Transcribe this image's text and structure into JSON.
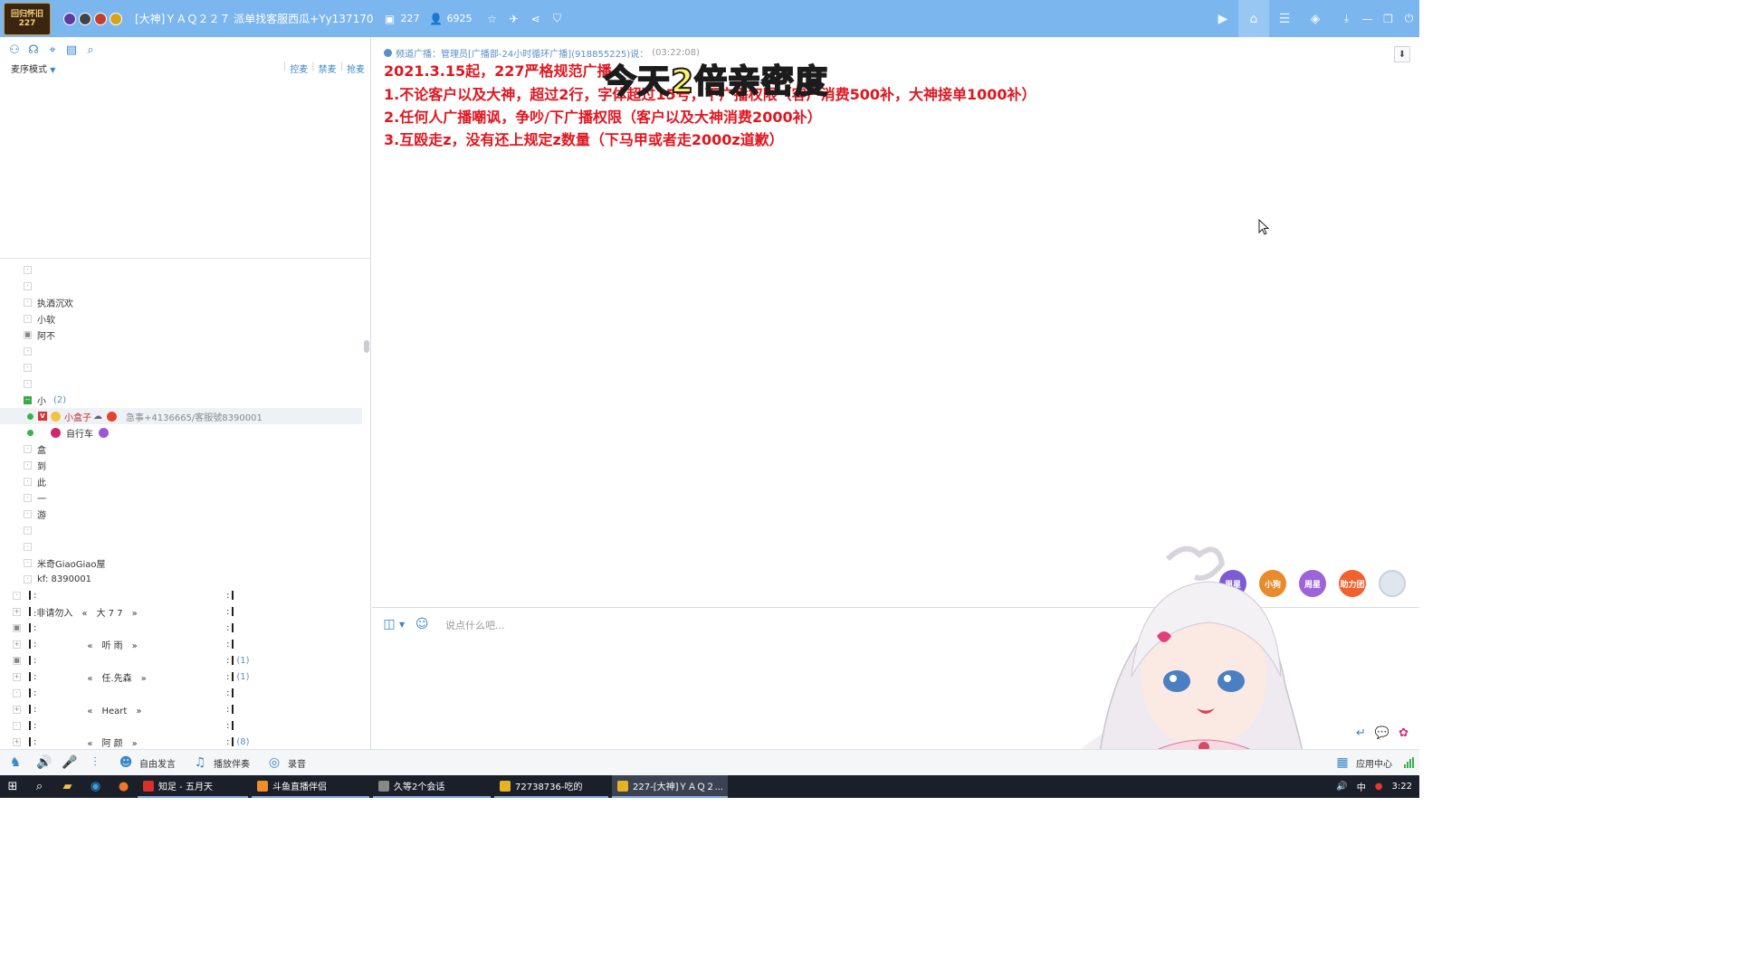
{
  "titlebar": {
    "logo_text": "回归怀旧\n227",
    "title": "[大神]ＹＡＱ２２７ 派单找客服西瓜+Yy137170",
    "channel_count": "227",
    "online_count": "6925"
  },
  "left_panel": {
    "mode_label": "麦序模式",
    "links": [
      "控麦",
      "禁麦",
      "抢麦"
    ],
    "tree": [
      {
        "type": "plain",
        "text": ""
      },
      {
        "type": "plain",
        "text": ""
      },
      {
        "type": "plain",
        "text": "执酒沉欢"
      },
      {
        "type": "plain",
        "text": "小软"
      },
      {
        "type": "lock",
        "text": "阿不"
      },
      {
        "type": "plain",
        "text": ""
      },
      {
        "type": "plain",
        "text": ""
      },
      {
        "type": "plain",
        "text": ""
      },
      {
        "type": "group",
        "text": "小",
        "count": "(2)"
      },
      {
        "type": "user_selected",
        "name": "小盒子",
        "note": "急事+4136665/客服號8390001"
      },
      {
        "type": "user",
        "name": "自行车",
        "note": ""
      },
      {
        "type": "plain",
        "text": "盒"
      },
      {
        "type": "plain",
        "text": "到"
      },
      {
        "type": "plain",
        "text": "此"
      },
      {
        "type": "plain",
        "text": "一"
      },
      {
        "type": "plain",
        "text": "游"
      },
      {
        "type": "plain",
        "text": ""
      },
      {
        "type": "plain",
        "text": ""
      },
      {
        "type": "plain",
        "text": "米奇GiaoGiao屋"
      },
      {
        "type": "plain",
        "text": "kf: 8390001"
      }
    ],
    "rooms": [
      {
        "box": "·",
        "label": ":",
        "name": "",
        "count": ""
      },
      {
        "box": "+",
        "label": ":非请勿入",
        "name": "«　大 7 7　»",
        "count": ""
      },
      {
        "box": "■",
        "label": ":",
        "name": "",
        "count": ""
      },
      {
        "box": "+",
        "label": ":",
        "name": "«　听 雨　»",
        "count": ""
      },
      {
        "box": "■",
        "label": ":",
        "name": "",
        "count": "(1)"
      },
      {
        "box": "+",
        "label": ":",
        "name": "«　任.先森　»",
        "count": "(1)"
      },
      {
        "box": "·",
        "label": ":",
        "name": "",
        "count": ""
      },
      {
        "box": "+",
        "label": ":",
        "name": "«　Heart　»",
        "count": ""
      },
      {
        "box": "·",
        "label": ":",
        "name": "",
        "count": ""
      },
      {
        "box": "+",
        "label": ":",
        "name": "«　阿 颜　»",
        "count": "(8)"
      }
    ]
  },
  "chat": {
    "broadcast_label": "频道广播：管理员[广播部-24小时循环广播](918855225)说：",
    "broadcast_time": "(03:22:08)",
    "rules": [
      "2021.3.15起，227严格规范广播",
      "1.不论客户以及大神，超过2行，字体超过15号，下广播权限（客户消费500补，大神接单1000补）",
      "2.任何人广播嘲讽，争吵/下广播权限（客户以及大神消费2000补）",
      "3.互殴走z，没有还上规定z数量（下马甲或者走2000z道歉）"
    ],
    "overlay_title": "今天2倍亲密度"
  },
  "input": {
    "placeholder": "说点什么吧...",
    "floating_icons": [
      "周星",
      "小狗",
      "周星",
      "助力团"
    ]
  },
  "bottombar": {
    "free_speak": "自由发言",
    "accompaniment": "播放伴奏",
    "record": "录音",
    "app_center": "应用中心"
  },
  "taskbar": {
    "tasks": [
      {
        "label": "知足 - 五月天",
        "color": "#d9302c"
      },
      {
        "label": "斗鱼直播伴侣",
        "color": "#f08c2a"
      },
      {
        "label": "久等2个会话",
        "color": "#888888"
      },
      {
        "label": "72738736-吃的",
        "color": "#e6b422"
      },
      {
        "label": "227-[大神]ＹＡＱ２...",
        "color": "#e6b422"
      }
    ],
    "ime": "中",
    "time": "3:22"
  },
  "colors": {
    "titlebar": "#7cb6ee",
    "accent": "#3a86c8",
    "rule_red": "#e0161f",
    "overlay_yellow": "#fff36b"
  }
}
